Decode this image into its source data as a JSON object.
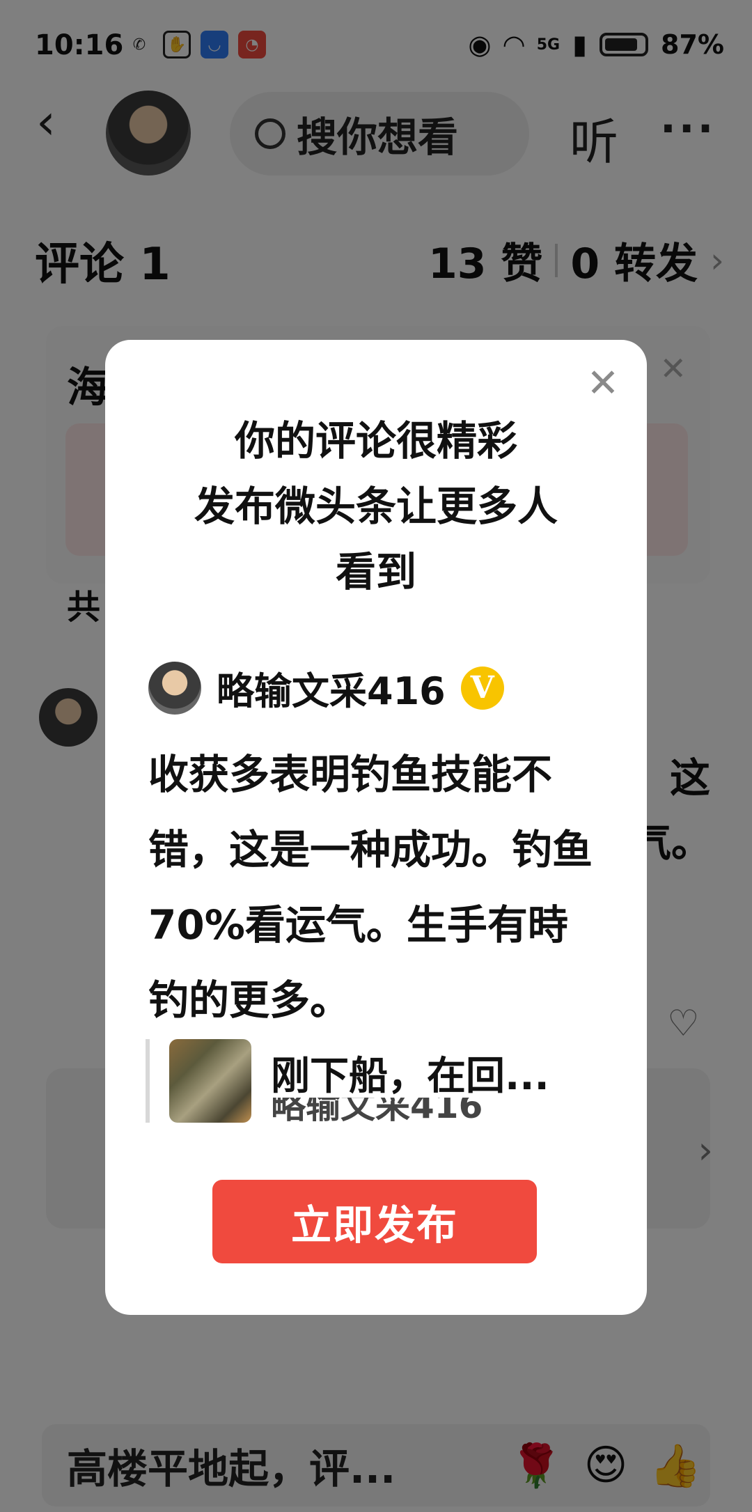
{
  "status_bar": {
    "time": "10:16",
    "network": "5G",
    "battery": "87%"
  },
  "header": {
    "search_placeholder": "搜你想看",
    "listen_label": "听",
    "more_label": "···"
  },
  "comments": {
    "title": "评论 1",
    "likes": "13 赞",
    "reposts": "0 转发"
  },
  "background": {
    "card_title_fragment": "海",
    "count_fragment": "共",
    "text_fragment_1": "这",
    "text_fragment_2": "气。",
    "comment_placeholder": "高楼平地起，评...",
    "emojis": [
      "🌹",
      "😍",
      "👍"
    ]
  },
  "modal": {
    "title_line1": "你的评论很精彩",
    "title_line2": "发布微头条让更多人",
    "title_line3": "看到",
    "author_name": "略输文采416",
    "badge": "V",
    "comment_text": "收获多表明钓鱼技能不错，这是一种成功。钓鱼70%看运气。生手有時钓的更多。",
    "quote_title": "刚下船，在回...",
    "quote_author": "略输文采416",
    "publish_button": "立即发布",
    "close_icon": "close-icon"
  },
  "colors": {
    "accent_red": "#f04a3e",
    "badge_yellow": "#f8c400",
    "overlay": "rgba(0,0,0,0.5)"
  }
}
